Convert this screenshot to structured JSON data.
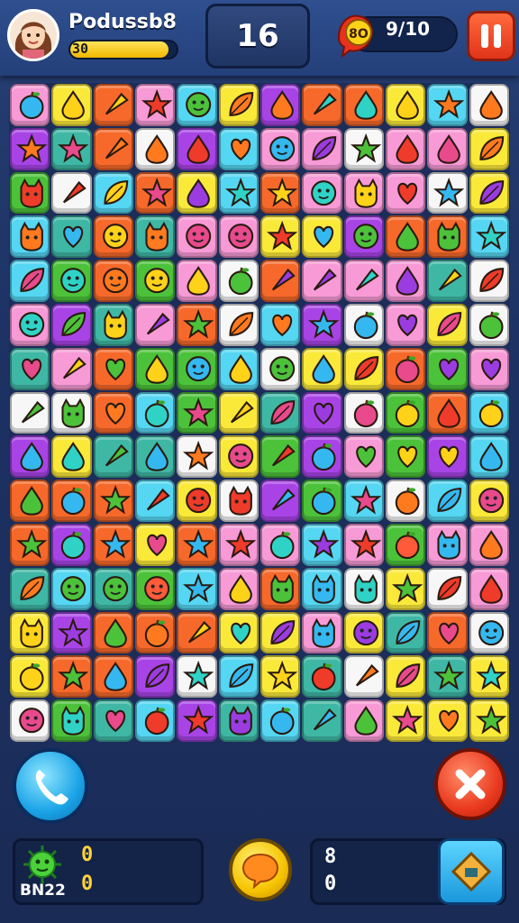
{
  "hud": {
    "player_name": "Podussb8",
    "xp_level": "30",
    "xp_progress": 0.92,
    "moves": "16",
    "target_icon_text": "8O",
    "target_count": "9/10",
    "pause_icon": "pause-icon"
  },
  "board": {
    "theme_colors": {
      "orange": "#f6692a",
      "yellow": "#fbe93a",
      "green": "#4cc23a",
      "pink": "#f79ad6",
      "purple": "#a844e6",
      "cyan": "#55d6f2",
      "red": "#ef3b2a",
      "white": "#f7f7f7",
      "teal": "#3fb7a5"
    },
    "grid_columns": 12,
    "grid_rows": 15,
    "candy_shapes": [
      "face",
      "heart",
      "star",
      "drop",
      "apple",
      "leaf",
      "cat",
      "carrot"
    ]
  },
  "controls": {
    "phone_icon": "phone-icon",
    "close_icon": "close-icon",
    "center_icon": "chat-bubble-icon",
    "booster_icon": "diamond-booster-icon"
  },
  "footer": {
    "level_label": "BN22",
    "left_stat_top": "0",
    "left_stat_bottom": "0",
    "right_stat_top": "8",
    "right_stat_bottom": "0"
  }
}
